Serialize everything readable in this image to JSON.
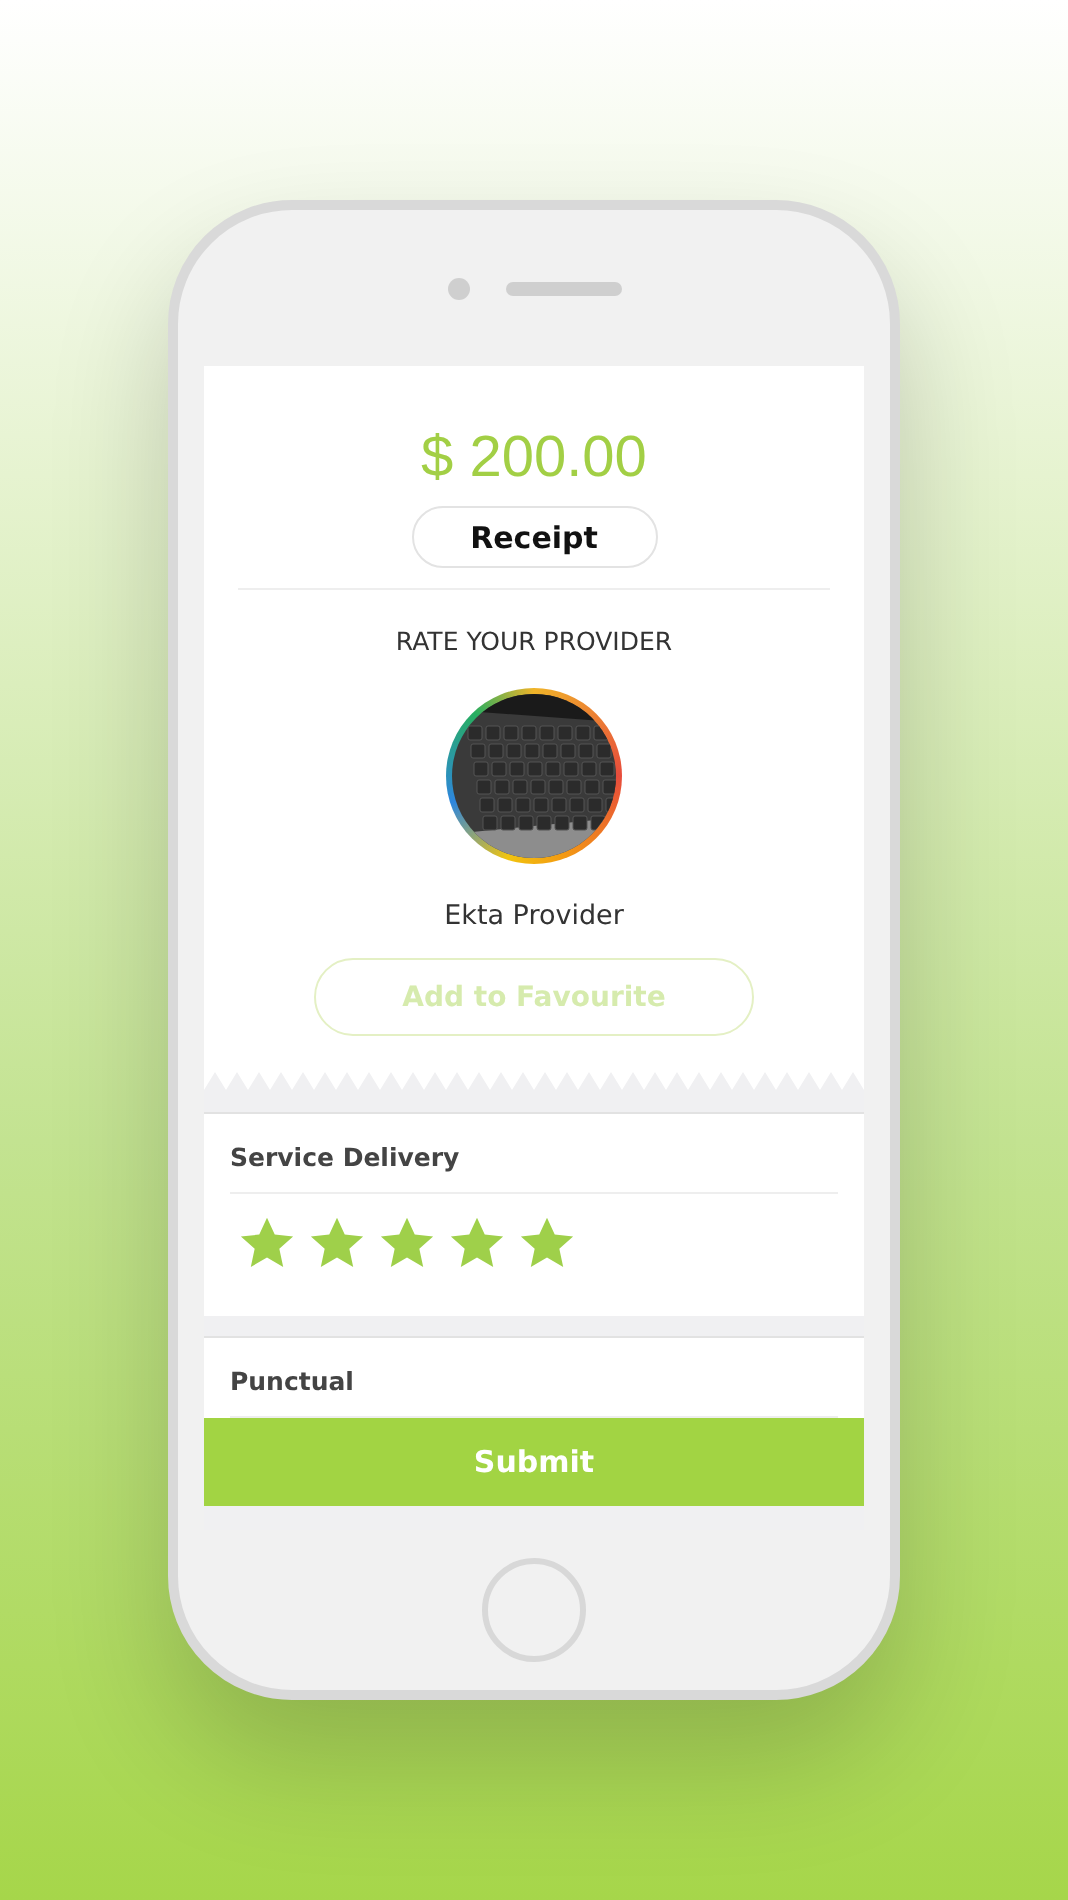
{
  "amount": "$ 200.00",
  "receipt_button": "Receipt",
  "rate_heading": "RATE YOUR PROVIDER",
  "provider": {
    "name": "Ekta Provider"
  },
  "favourite_button": "Add to Favourite",
  "ratings": [
    {
      "label": "Service Delivery",
      "stars": 5
    },
    {
      "label": "Punctual"
    }
  ],
  "submit_button": "Submit"
}
